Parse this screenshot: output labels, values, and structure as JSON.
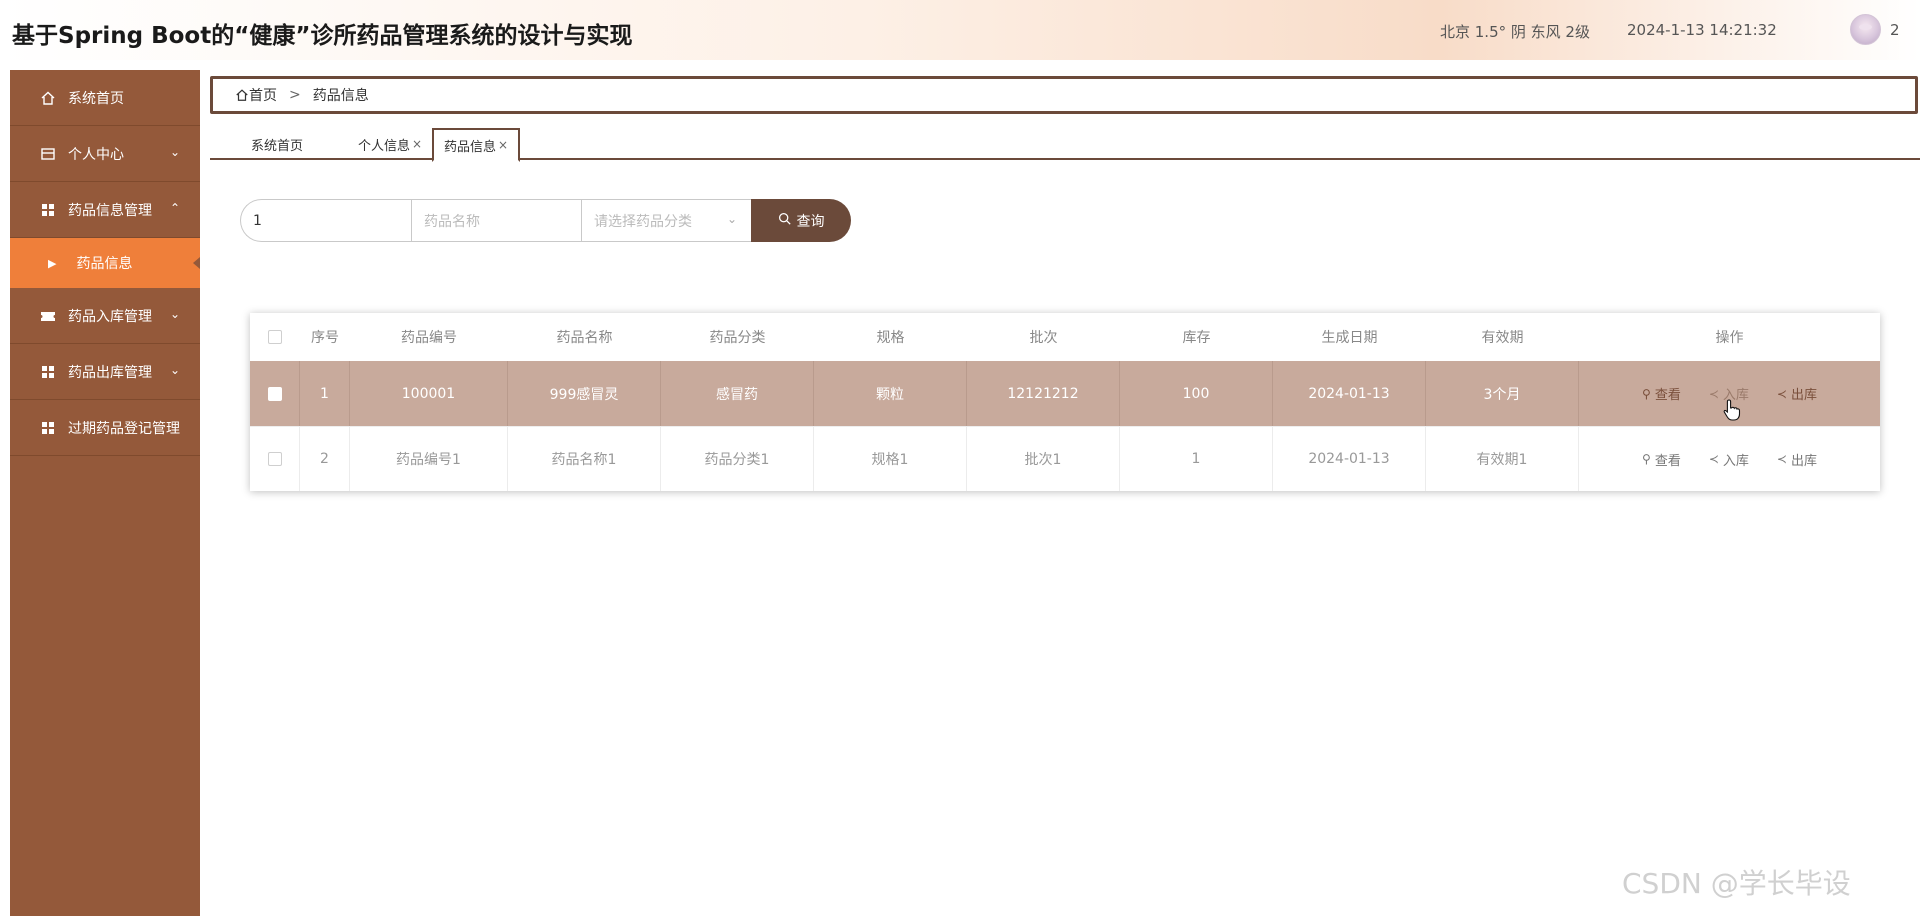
{
  "header": {
    "title": "基于Spring Boot的“健康”诊所药品管理系统的设计与实现",
    "weather": "北京  1.5°  阴  东风  2级",
    "datetime": "2024-1-13 14:21:32",
    "user_number": "2"
  },
  "sidebar": {
    "items": [
      {
        "label": "系统首页",
        "icon": "home-icon"
      },
      {
        "label": "个人中心",
        "icon": "card-icon",
        "chevron": "⌄"
      },
      {
        "label": "药品信息管理",
        "icon": "grid-icon",
        "chevron": "⌃"
      },
      {
        "label": "药品入库管理",
        "icon": "ticket-icon",
        "chevron": "⌄"
      },
      {
        "label": "药品出库管理",
        "icon": "grid-icon",
        "chevron": "⌄"
      },
      {
        "label": "过期药品登记管理",
        "icon": "grid-icon"
      }
    ],
    "active_sub": "药品信息"
  },
  "breadcrumb": {
    "home": "首页",
    "sep": ">",
    "current": "药品信息"
  },
  "tabs": [
    {
      "label": "系统首页"
    },
    {
      "label": "个人信息",
      "close": "×"
    },
    {
      "label": "药品信息",
      "close": "×"
    }
  ],
  "search": {
    "field1_value": "1",
    "field2_placeholder": "药品名称",
    "field3_placeholder": "请选择药品分类",
    "button_label": "查询"
  },
  "table": {
    "columns": [
      "序号",
      "药品编号",
      "药品名称",
      "药品分类",
      "规格",
      "批次",
      "库存",
      "生成日期",
      "有效期",
      "操作"
    ],
    "rows": [
      [
        "1",
        "100001",
        "999感冒灵",
        "感冒药",
        "颗粒",
        "12121212",
        "100",
        "2024-01-13",
        "3个月"
      ],
      [
        "2",
        "药品编号1",
        "药品名称1",
        "药品分类1",
        "规格1",
        "批次1",
        "1",
        "2024-01-13",
        "有效期1"
      ]
    ],
    "actions": [
      "查看",
      "入库",
      "出库"
    ]
  },
  "watermark": "CSDN @学长毕设",
  "colors": {
    "sidebar": "#94593a",
    "active": "#ef7f3a",
    "accent": "#6b4a3a",
    "selected_row": "#c8aa9c"
  }
}
